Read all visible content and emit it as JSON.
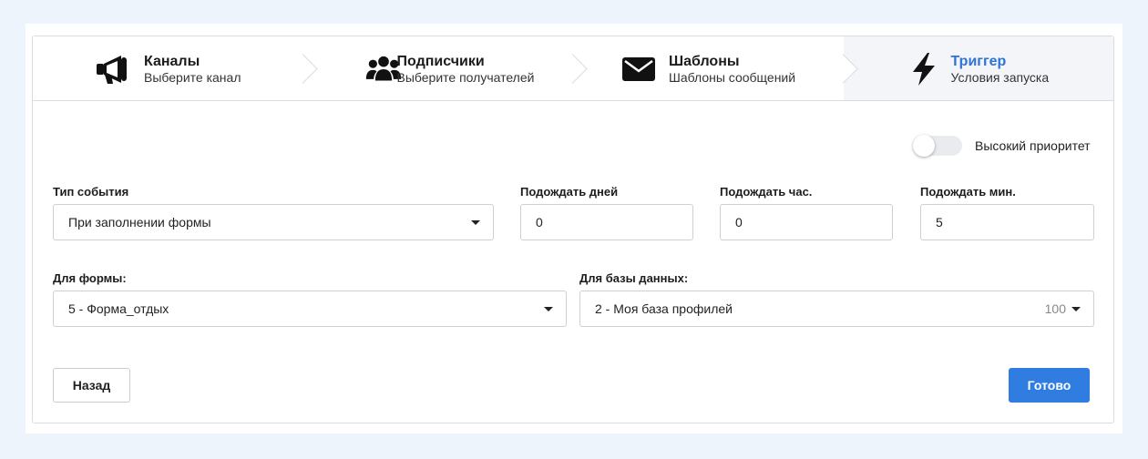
{
  "steps": [
    {
      "title": "Каналы",
      "subtitle": "Выберите канал",
      "icon": "megaphone-icon"
    },
    {
      "title": "Подписчики",
      "subtitle": "Выберите получателей",
      "icon": "users-icon"
    },
    {
      "title": "Шаблоны",
      "subtitle": "Шаблоны сообщений",
      "icon": "envelope-icon"
    },
    {
      "title": "Триггер",
      "subtitle": "Условия запуска",
      "icon": "lightning-icon",
      "active": true
    }
  ],
  "priority": {
    "label": "Высокий приоритет",
    "enabled": false
  },
  "event_type": {
    "label": "Тип события",
    "value": "При заполнении формы"
  },
  "wait_days": {
    "label": "Подождать дней",
    "value": "0"
  },
  "wait_hours": {
    "label": "Подождать час.",
    "value": "0"
  },
  "wait_minutes": {
    "label": "Подождать мин.",
    "value": "5"
  },
  "form": {
    "label": "Для формы:",
    "value": "5 - Форма_отдых"
  },
  "database": {
    "label": "Для базы данных:",
    "value": "2 - Моя база профилей",
    "count": "100"
  },
  "buttons": {
    "back": "Назад",
    "done": "Готово"
  },
  "colors": {
    "accent": "#2f7de1",
    "active_step_title": "#2d74d8",
    "background": "#eef4fc"
  }
}
